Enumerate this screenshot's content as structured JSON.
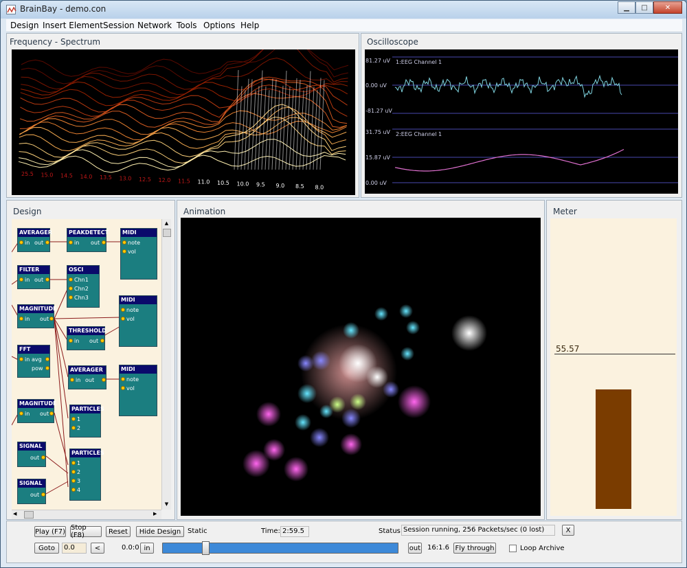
{
  "window": {
    "title": "BrainBay - demo.con",
    "minimize": "▁",
    "maximize": "□",
    "close": "✕"
  },
  "menu": [
    "Design",
    "Insert Element",
    "Session",
    "Network",
    "Tools",
    "Options",
    "Help"
  ],
  "panels": {
    "spectrum": {
      "title": "Frequency - Spectrum",
      "freq_labels": [
        "25.5",
        "15.0",
        "14.5",
        "14.0",
        "13.5",
        "13.0",
        "12.5",
        "12.0",
        "11.5",
        "11.0",
        "10.5",
        "10.0",
        "9.5",
        "9.0",
        "8.5",
        "8.0"
      ]
    },
    "oscilloscope": {
      "title": "Oscilloscope",
      "channels": [
        {
          "name": "1:EEG Channel 1",
          "top": "81.27 uV",
          "mid": "0.00 uV",
          "bottom": "-81.27 uV",
          "color": "#7fd4e0"
        },
        {
          "name": "2:EEG Channel 1",
          "top": "31.75 uV",
          "mid": "15.87 uV",
          "bottom": "0.00 uV",
          "color": "#e070d0"
        }
      ]
    },
    "design": {
      "title": "Design",
      "nodes": [
        {
          "id": "averager1",
          "title": "AVERAGER",
          "ports": [
            "in",
            "out"
          ]
        },
        {
          "id": "peakdetect",
          "title": "PEAKDETECT",
          "ports": [
            "in",
            "out"
          ]
        },
        {
          "id": "midi1",
          "title": "MIDI",
          "ports": [
            "note",
            "vol"
          ]
        },
        {
          "id": "filter",
          "title": "FILTER",
          "ports": [
            "in",
            "out"
          ]
        },
        {
          "id": "osci",
          "title": "OSCI",
          "ports": [
            "Chn1",
            "Chn2",
            "Chn3"
          ]
        },
        {
          "id": "magnitude1",
          "title": "MAGNITUDE",
          "ports": [
            "in",
            "out"
          ]
        },
        {
          "id": "midi2",
          "title": "MIDI",
          "ports": [
            "note",
            "vol"
          ]
        },
        {
          "id": "threshold",
          "title": "THRESHOLD",
          "ports": [
            "in",
            "out"
          ]
        },
        {
          "id": "fft",
          "title": "FFT",
          "ports": [
            "in",
            "avg",
            "pow"
          ]
        },
        {
          "id": "averager2",
          "title": "AVERAGER",
          "ports": [
            "in",
            "out"
          ]
        },
        {
          "id": "midi3",
          "title": "MIDI",
          "ports": [
            "note",
            "vol"
          ]
        },
        {
          "id": "magnitude2",
          "title": "MAGNITUDE",
          "ports": [
            "in",
            "out"
          ]
        },
        {
          "id": "particles1",
          "title": "PARTICLES",
          "ports": [
            "1",
            "2"
          ]
        },
        {
          "id": "signal1",
          "title": "SIGNAL",
          "ports": [
            "out"
          ]
        },
        {
          "id": "particles2",
          "title": "PARTICLES",
          "ports": [
            "1",
            "2",
            "3",
            "4"
          ]
        },
        {
          "id": "signal2",
          "title": "SIGNAL",
          "ports": [
            "out"
          ]
        }
      ]
    },
    "animation": {
      "title": "Animation"
    },
    "meter": {
      "title": "Meter",
      "value": "55.57",
      "level": 0.55,
      "bar_color": "#7a3c00"
    }
  },
  "controls": {
    "play": "Play (F7)",
    "stop": "Stop (F8)",
    "reset": "Reset",
    "hide_design": "Hide Design",
    "mode": "Static",
    "time_label": "Time:",
    "time_value": "2:59.5",
    "status_label": "Status:",
    "status_value": "Session running,  256 Packets/sec (0 lost)",
    "status_close": "X",
    "goto": "Goto",
    "goto_value": "0.0",
    "prev": "<",
    "pos_start": "0.0:0",
    "in_btn": "in",
    "out_btn": "out",
    "pos_end": "16:1.6",
    "fly_through": "Fly through",
    "loop_archive": "Loop Archive",
    "loop_checked": false,
    "slider_fraction": 0.18
  }
}
